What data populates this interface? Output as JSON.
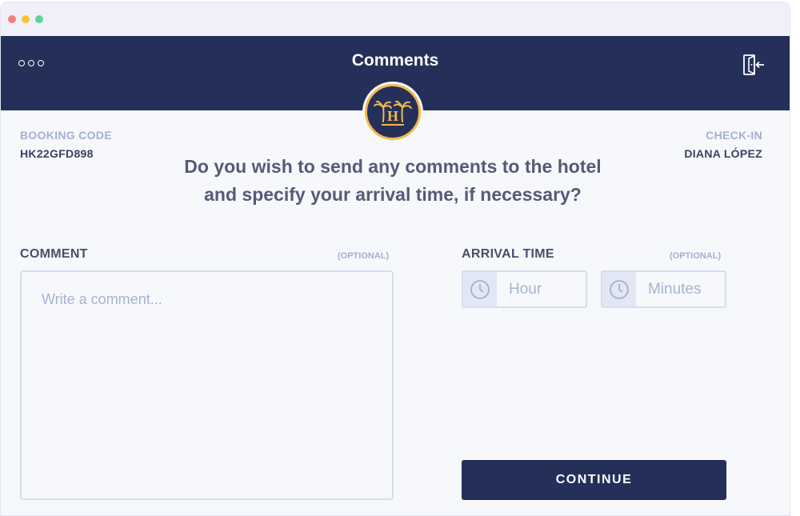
{
  "header": {
    "title": "Comments",
    "menu_icon": "more-dots-icon",
    "exit_icon": "exit-door-icon",
    "logo_text": "H"
  },
  "booking": {
    "code_label": "BOOKING CODE",
    "code_value": "HK22GFD898"
  },
  "checkin": {
    "label": "CHECK-IN",
    "name": "DIANA LÓPEZ"
  },
  "question": {
    "line1": "Do you wish to send any comments to the hotel",
    "line2": "and specify your arrival time, if necessary?"
  },
  "comment": {
    "label": "COMMENT",
    "optional": "(OPTIONAL)",
    "placeholder": "Write a comment...",
    "value": ""
  },
  "arrival": {
    "label": "ARRIVAL TIME",
    "optional": "(OPTIONAL)",
    "hour_placeholder": "Hour",
    "minutes_placeholder": "Minutes",
    "hour_value": "",
    "minutes_value": "",
    "icon": "clock-icon"
  },
  "actions": {
    "continue_label": "CONTINUE"
  },
  "colors": {
    "navy": "#24305a",
    "accent_gold": "#f4b84a",
    "muted_label": "#a3b0cf",
    "background": "#f7f8fc"
  }
}
